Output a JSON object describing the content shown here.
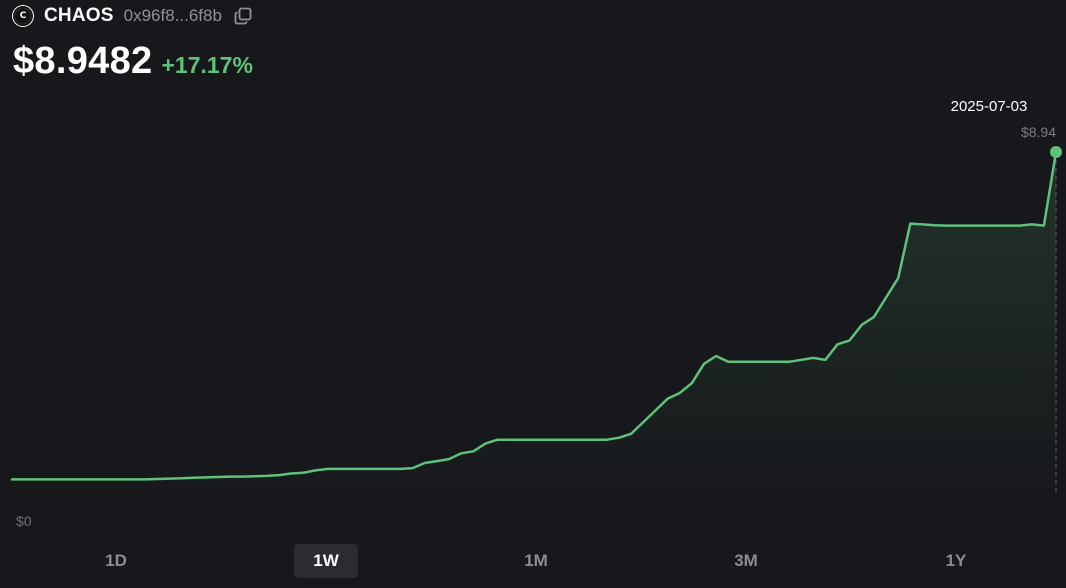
{
  "token": {
    "logo_letter": "C",
    "symbol": "CHAOS",
    "address": "0x96f8...6f8b"
  },
  "price": {
    "value": "$8.9482",
    "change": "+17.17%"
  },
  "colors": {
    "background": "#17181c",
    "line": "#5ec27a",
    "positive": "#5ec27a",
    "muted": "#8e9197",
    "active_range_bg": "#2a2c31"
  },
  "tooltip": {
    "date": "2025-07-03",
    "price": "$8.94"
  },
  "ranges": [
    {
      "label": "1D",
      "active": false
    },
    {
      "label": "1W",
      "active": true
    },
    {
      "label": "1M",
      "active": false
    },
    {
      "label": "3M",
      "active": false
    },
    {
      "label": "1Y",
      "active": false
    }
  ],
  "chart_data": {
    "type": "line",
    "y_min_label": "$0",
    "ylim": [
      0,
      8.94
    ],
    "highlight_index": 86,
    "series": [
      {
        "values": [
          0.53,
          0.53,
          0.53,
          0.53,
          0.53,
          0.53,
          0.53,
          0.53,
          0.53,
          0.53,
          0.53,
          0.53,
          0.54,
          0.55,
          0.56,
          0.57,
          0.58,
          0.59,
          0.6,
          0.6,
          0.61,
          0.62,
          0.64,
          0.68,
          0.7,
          0.76,
          0.8,
          0.8,
          0.8,
          0.8,
          0.8,
          0.8,
          0.8,
          0.82,
          0.95,
          1.0,
          1.05,
          1.2,
          1.25,
          1.45,
          1.55,
          1.55,
          1.55,
          1.55,
          1.55,
          1.55,
          1.55,
          1.55,
          1.55,
          1.55,
          1.6,
          1.7,
          2.0,
          2.3,
          2.6,
          2.75,
          3.0,
          3.5,
          3.7,
          3.55,
          3.55,
          3.55,
          3.55,
          3.55,
          3.55,
          3.6,
          3.65,
          3.6,
          4.0,
          4.1,
          4.5,
          4.7,
          5.2,
          5.7,
          7.1,
          7.08,
          7.06,
          7.05,
          7.05,
          7.05,
          7.05,
          7.05,
          7.05,
          7.05,
          7.08,
          7.05,
          8.94
        ]
      }
    ]
  }
}
